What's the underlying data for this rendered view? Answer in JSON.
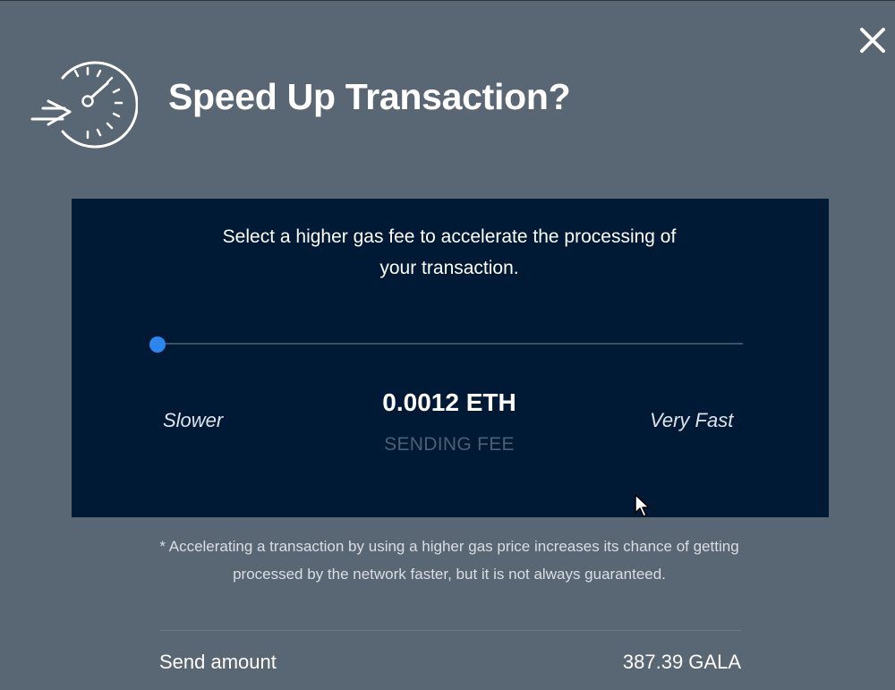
{
  "dialog": {
    "title": "Speed Up Transaction?",
    "close_icon": "close-icon",
    "header_icon": "speedometer-arrow-icon"
  },
  "gas_panel": {
    "instruction_line1": "Select a higher gas fee to accelerate the processing of",
    "instruction_line2": "your transaction.",
    "slider": {
      "level": 0,
      "min_label": "Slower",
      "max_label": "Very Fast"
    },
    "fee_value": "0.0012 ETH",
    "fee_caption": "SENDING FEE"
  },
  "note": {
    "line1": "* Accelerating a transaction by using a higher gas price increases its chance of getting",
    "line2": "processed by the network faster, but it is not always guaranteed."
  },
  "summary": {
    "send_amount_label": "Send amount",
    "send_amount_value": "387.39 GALA"
  },
  "colors": {
    "modal_bg": "#596673",
    "panel_bg": "#001935",
    "accent": "#2b86f0",
    "text": "#ffffff"
  }
}
